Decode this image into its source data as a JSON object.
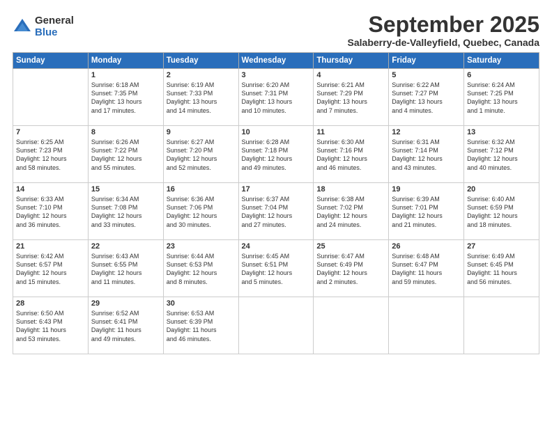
{
  "logo": {
    "general": "General",
    "blue": "Blue"
  },
  "title": "September 2025",
  "location": "Salaberry-de-Valleyfield, Quebec, Canada",
  "days_of_week": [
    "Sunday",
    "Monday",
    "Tuesday",
    "Wednesday",
    "Thursday",
    "Friday",
    "Saturday"
  ],
  "weeks": [
    [
      {
        "day": "",
        "content": ""
      },
      {
        "day": "1",
        "content": "Sunrise: 6:18 AM\nSunset: 7:35 PM\nDaylight: 13 hours\nand 17 minutes."
      },
      {
        "day": "2",
        "content": "Sunrise: 6:19 AM\nSunset: 7:33 PM\nDaylight: 13 hours\nand 14 minutes."
      },
      {
        "day": "3",
        "content": "Sunrise: 6:20 AM\nSunset: 7:31 PM\nDaylight: 13 hours\nand 10 minutes."
      },
      {
        "day": "4",
        "content": "Sunrise: 6:21 AM\nSunset: 7:29 PM\nDaylight: 13 hours\nand 7 minutes."
      },
      {
        "day": "5",
        "content": "Sunrise: 6:22 AM\nSunset: 7:27 PM\nDaylight: 13 hours\nand 4 minutes."
      },
      {
        "day": "6",
        "content": "Sunrise: 6:24 AM\nSunset: 7:25 PM\nDaylight: 13 hours\nand 1 minute."
      }
    ],
    [
      {
        "day": "7",
        "content": "Sunrise: 6:25 AM\nSunset: 7:23 PM\nDaylight: 12 hours\nand 58 minutes."
      },
      {
        "day": "8",
        "content": "Sunrise: 6:26 AM\nSunset: 7:22 PM\nDaylight: 12 hours\nand 55 minutes."
      },
      {
        "day": "9",
        "content": "Sunrise: 6:27 AM\nSunset: 7:20 PM\nDaylight: 12 hours\nand 52 minutes."
      },
      {
        "day": "10",
        "content": "Sunrise: 6:28 AM\nSunset: 7:18 PM\nDaylight: 12 hours\nand 49 minutes."
      },
      {
        "day": "11",
        "content": "Sunrise: 6:30 AM\nSunset: 7:16 PM\nDaylight: 12 hours\nand 46 minutes."
      },
      {
        "day": "12",
        "content": "Sunrise: 6:31 AM\nSunset: 7:14 PM\nDaylight: 12 hours\nand 43 minutes."
      },
      {
        "day": "13",
        "content": "Sunrise: 6:32 AM\nSunset: 7:12 PM\nDaylight: 12 hours\nand 40 minutes."
      }
    ],
    [
      {
        "day": "14",
        "content": "Sunrise: 6:33 AM\nSunset: 7:10 PM\nDaylight: 12 hours\nand 36 minutes."
      },
      {
        "day": "15",
        "content": "Sunrise: 6:34 AM\nSunset: 7:08 PM\nDaylight: 12 hours\nand 33 minutes."
      },
      {
        "day": "16",
        "content": "Sunrise: 6:36 AM\nSunset: 7:06 PM\nDaylight: 12 hours\nand 30 minutes."
      },
      {
        "day": "17",
        "content": "Sunrise: 6:37 AM\nSunset: 7:04 PM\nDaylight: 12 hours\nand 27 minutes."
      },
      {
        "day": "18",
        "content": "Sunrise: 6:38 AM\nSunset: 7:02 PM\nDaylight: 12 hours\nand 24 minutes."
      },
      {
        "day": "19",
        "content": "Sunrise: 6:39 AM\nSunset: 7:01 PM\nDaylight: 12 hours\nand 21 minutes."
      },
      {
        "day": "20",
        "content": "Sunrise: 6:40 AM\nSunset: 6:59 PM\nDaylight: 12 hours\nand 18 minutes."
      }
    ],
    [
      {
        "day": "21",
        "content": "Sunrise: 6:42 AM\nSunset: 6:57 PM\nDaylight: 12 hours\nand 15 minutes."
      },
      {
        "day": "22",
        "content": "Sunrise: 6:43 AM\nSunset: 6:55 PM\nDaylight: 12 hours\nand 11 minutes."
      },
      {
        "day": "23",
        "content": "Sunrise: 6:44 AM\nSunset: 6:53 PM\nDaylight: 12 hours\nand 8 minutes."
      },
      {
        "day": "24",
        "content": "Sunrise: 6:45 AM\nSunset: 6:51 PM\nDaylight: 12 hours\nand 5 minutes."
      },
      {
        "day": "25",
        "content": "Sunrise: 6:47 AM\nSunset: 6:49 PM\nDaylight: 12 hours\nand 2 minutes."
      },
      {
        "day": "26",
        "content": "Sunrise: 6:48 AM\nSunset: 6:47 PM\nDaylight: 11 hours\nand 59 minutes."
      },
      {
        "day": "27",
        "content": "Sunrise: 6:49 AM\nSunset: 6:45 PM\nDaylight: 11 hours\nand 56 minutes."
      }
    ],
    [
      {
        "day": "28",
        "content": "Sunrise: 6:50 AM\nSunset: 6:43 PM\nDaylight: 11 hours\nand 53 minutes."
      },
      {
        "day": "29",
        "content": "Sunrise: 6:52 AM\nSunset: 6:41 PM\nDaylight: 11 hours\nand 49 minutes."
      },
      {
        "day": "30",
        "content": "Sunrise: 6:53 AM\nSunset: 6:39 PM\nDaylight: 11 hours\nand 46 minutes."
      },
      {
        "day": "",
        "content": ""
      },
      {
        "day": "",
        "content": ""
      },
      {
        "day": "",
        "content": ""
      },
      {
        "day": "",
        "content": ""
      }
    ]
  ]
}
